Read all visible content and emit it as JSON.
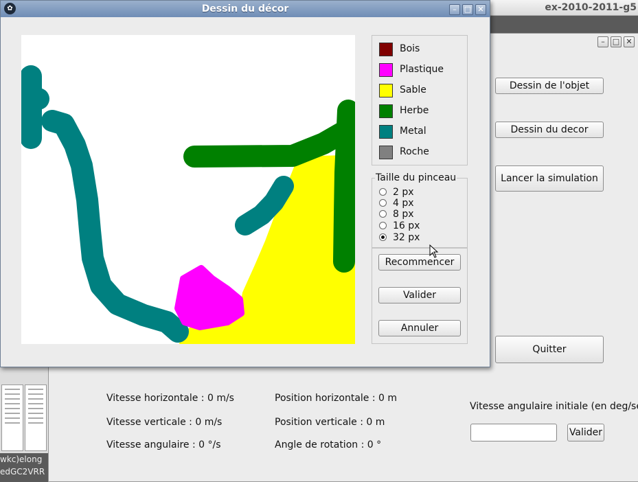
{
  "background": {
    "window_title_fragment": "ex-2010-2011-g5",
    "desktop_label": "wkc)elong\nedGC2VRR",
    "main_window": {
      "buttons": {
        "dessin_objet": "Dessin de l'objet",
        "dessin_decor": "Dessin du decor",
        "lancer": "Lancer la simulation",
        "quitter": "Quitter",
        "valider": "Valider"
      },
      "stats": {
        "vitesse_h": "Vitesse horizontale : 0 m/s",
        "vitesse_v": "Vitesse verticale : 0 m/s",
        "vitesse_a": "Vitesse angulaire : 0 °/s",
        "position_h": "Position horizontale : 0 m",
        "position_v": "Position verticale : 0 m",
        "angle": "Angle de rotation : 0 °"
      },
      "angular_label": "Vitesse angulaire initiale (en deg/sec",
      "angular_value": ""
    }
  },
  "dialog": {
    "title": "Dessin du décor",
    "materials": [
      {
        "label": "Bois",
        "color": "#800000"
      },
      {
        "label": "Plastique",
        "color": "#ff00ff"
      },
      {
        "label": "Sable",
        "color": "#ffff00"
      },
      {
        "label": "Herbe",
        "color": "#008000"
      },
      {
        "label": "Metal",
        "color": "#008080"
      },
      {
        "label": "Roche",
        "color": "#808080"
      }
    ],
    "brush": {
      "title": "Taille du pinceau",
      "options": [
        "2 px",
        "4 px",
        "8 px",
        "16 px",
        "32 px"
      ],
      "selected": "32 px"
    },
    "buttons": {
      "recommencer": "Recommencer",
      "valider": "Valider",
      "annuler": "Annuler"
    }
  }
}
